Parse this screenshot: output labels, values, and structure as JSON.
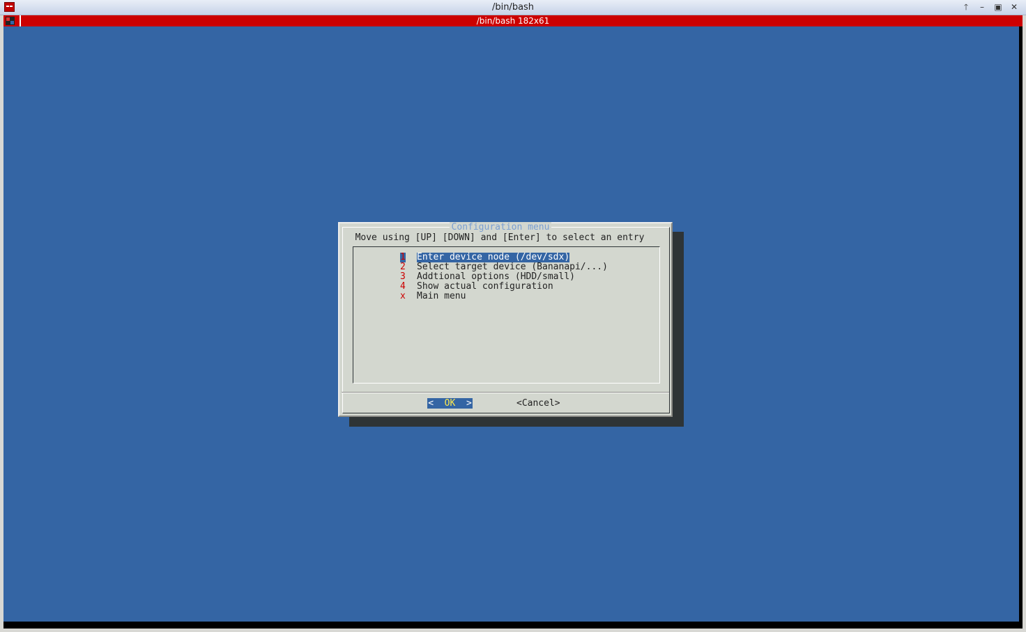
{
  "window": {
    "title": "/bin/bash",
    "buttons": [
      "up-arrow-icon",
      "minimize-icon",
      "maximize-icon",
      "close-icon"
    ]
  },
  "tab": {
    "title": "/bin/bash 182x61"
  },
  "colors": {
    "terminal_bg": "#3465a4",
    "tabbar_bg": "#cc0000",
    "dialog_bg": "#d3d7cf",
    "shadow": "#2e3436",
    "title_color": "#7a9fd1",
    "tag_color": "#cc0000",
    "ok_label_color": "#fce94f"
  },
  "dialog": {
    "title": "Configuration menu",
    "prompt": "Move using [UP] [DOWN] and [Enter] to select an entry",
    "items": [
      {
        "tag": "1",
        "label": "Enter device node (/dev/sdx)",
        "selected": true
      },
      {
        "tag": "2",
        "label": "Select target device (Bananapi/...)",
        "selected": false
      },
      {
        "tag": "3",
        "label": "Addtional options (HDD/small)",
        "selected": false
      },
      {
        "tag": "4",
        "label": "Show actual configuration",
        "selected": false
      },
      {
        "tag": "x",
        "label": "Main menu",
        "selected": false
      }
    ],
    "ok_left": "<",
    "ok_label": "OK",
    "ok_right": ">",
    "cancel_left": "<",
    "cancel_label": "Cancel",
    "cancel_right": ">"
  }
}
